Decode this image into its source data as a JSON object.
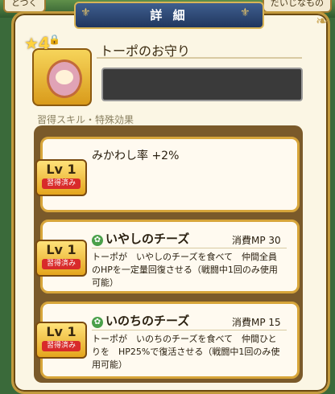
{
  "header": {
    "tab_left": "とつく",
    "tab_right": "だいじなもの",
    "title": "詳 細"
  },
  "item": {
    "stars": "★4",
    "name": "トーポのお守り"
  },
  "section_label": "習得スキル・特殊効果",
  "skills": [
    {
      "lv": "Lv 1",
      "learned": "習得済み",
      "title": "みかわし率 +2%"
    },
    {
      "lv": "Lv 1",
      "learned": "習得済み",
      "title": "いやしのチーズ",
      "mp_label": "消費MP",
      "mp_value": "30",
      "desc": "トーポが　いやしのチーズを食べて　仲間全員のHPを一定量回復させる（戦闘中1回のみ使用可能）"
    },
    {
      "lv": "Lv 1",
      "learned": "習得済み",
      "title": "いのちのチーズ",
      "mp_label": "消費MP",
      "mp_value": "15",
      "desc": "トーポが　いのちのチーズを食べて　仲間ひとりを　HP25%で復活させる（戦闘中1回のみ使用可能）"
    }
  ]
}
